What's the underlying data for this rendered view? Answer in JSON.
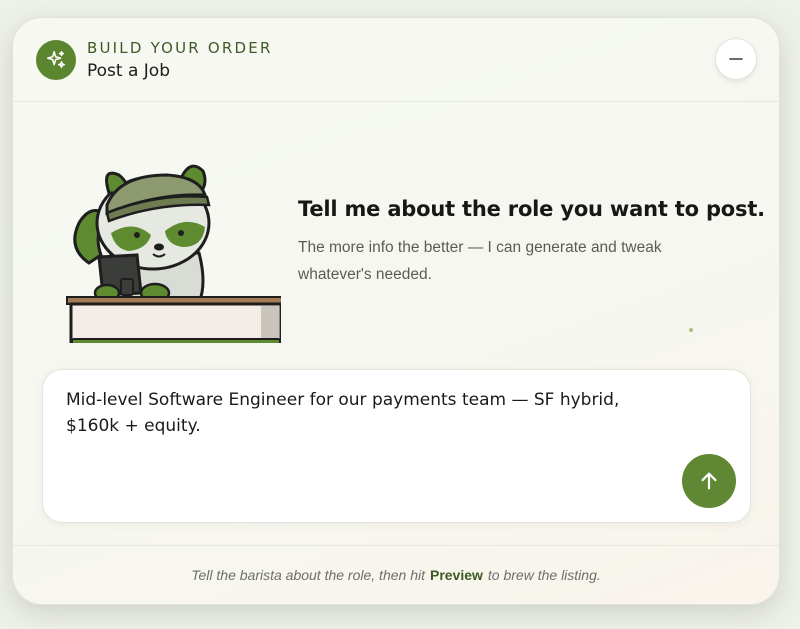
{
  "header": {
    "eyebrow": "BUILD YOUR ORDER",
    "title": "Post a Job",
    "badge_icon": "sparkle-icon",
    "collapse_icon": "minus-icon"
  },
  "prompt": {
    "heading": "Tell me about the role you want to post.",
    "subtext": "The more info the better — I can generate and tweak whatever's needed."
  },
  "input": {
    "value": "Mid-level Software Engineer for our payments team — SF hybrid, $160k + equity.",
    "send_icon": "arrow-up-icon"
  },
  "footer": {
    "before": "Tell the barista about the role, then hit",
    "action": "Preview",
    "after": "to brew the listing."
  },
  "colors": {
    "accent": "#5f8734",
    "eyebrow": "#3f5a27"
  }
}
